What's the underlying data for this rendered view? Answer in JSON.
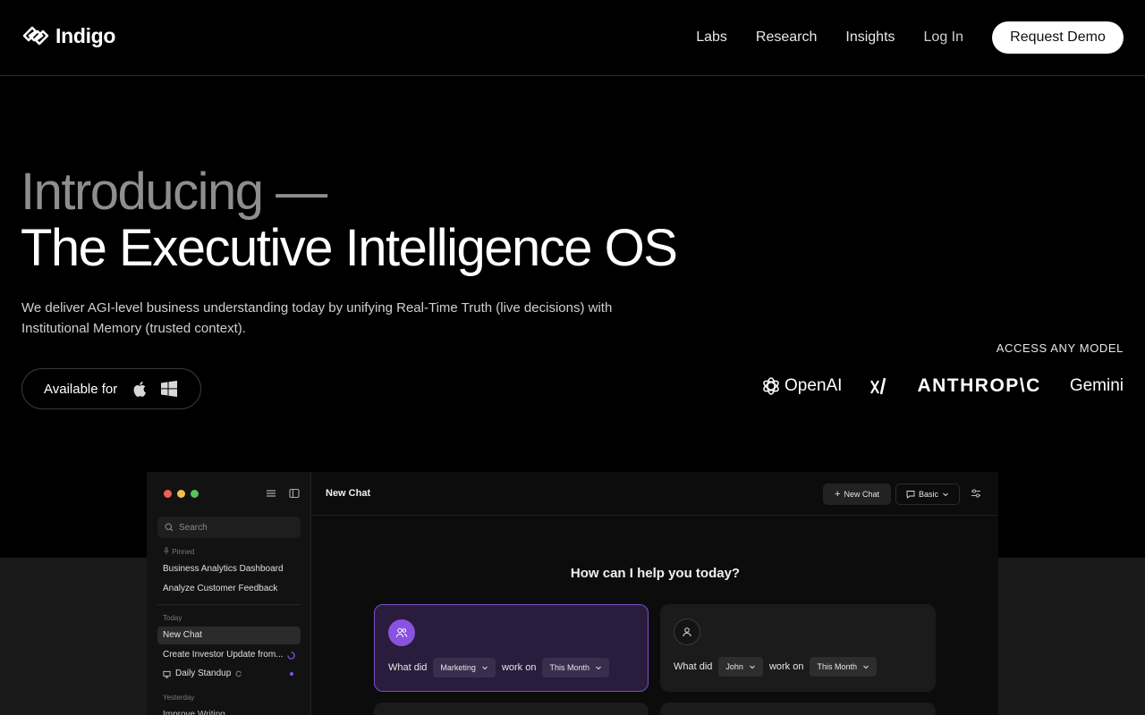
{
  "brand": {
    "name": "Indigo"
  },
  "nav": {
    "links": [
      "Labs",
      "Research",
      "Insights"
    ],
    "login": "Log In",
    "cta": "Request Demo"
  },
  "hero": {
    "intro": "Introducing —",
    "title": "The Executive Intelligence OS",
    "description": "We deliver AGI-level business understanding today by unifying Real-Time Truth (live decisions) with Institutional Memory (trusted context).",
    "available_label": "Available for"
  },
  "models": {
    "label": "ACCESS ANY MODEL",
    "openai": "OpenAI",
    "xai": "x/",
    "anthropic": "ANTHROP\\C",
    "gemini": "Gemini"
  },
  "app": {
    "search_placeholder": "Search",
    "sections": {
      "pinned": "Pinned",
      "today": "Today",
      "yesterday": "Yesterday"
    },
    "pinned_items": [
      "Business Analytics Dashboard",
      "Analyze Customer Feedback"
    ],
    "today_items": [
      "New Chat",
      "Create Investor Update from...",
      "Daily Standup"
    ],
    "yesterday_items": [
      "Improve Writing"
    ],
    "header_title": "New Chat",
    "new_chat_label": "New Chat",
    "mode_label": "Basic",
    "prompt_heading": "How can I help you today?",
    "card1": {
      "prefix": "What did",
      "subject": "Marketing",
      "middle": "work on",
      "period": "This Month"
    },
    "card2": {
      "prefix": "What did",
      "subject": "John",
      "middle": "work on",
      "period": "This Month"
    }
  },
  "colors": {
    "background": "#000000",
    "accent_purple": "#8a52e0",
    "traffic_red": "#ee5f57",
    "traffic_yellow": "#f5bd4f",
    "traffic_green": "#5ac05a"
  }
}
